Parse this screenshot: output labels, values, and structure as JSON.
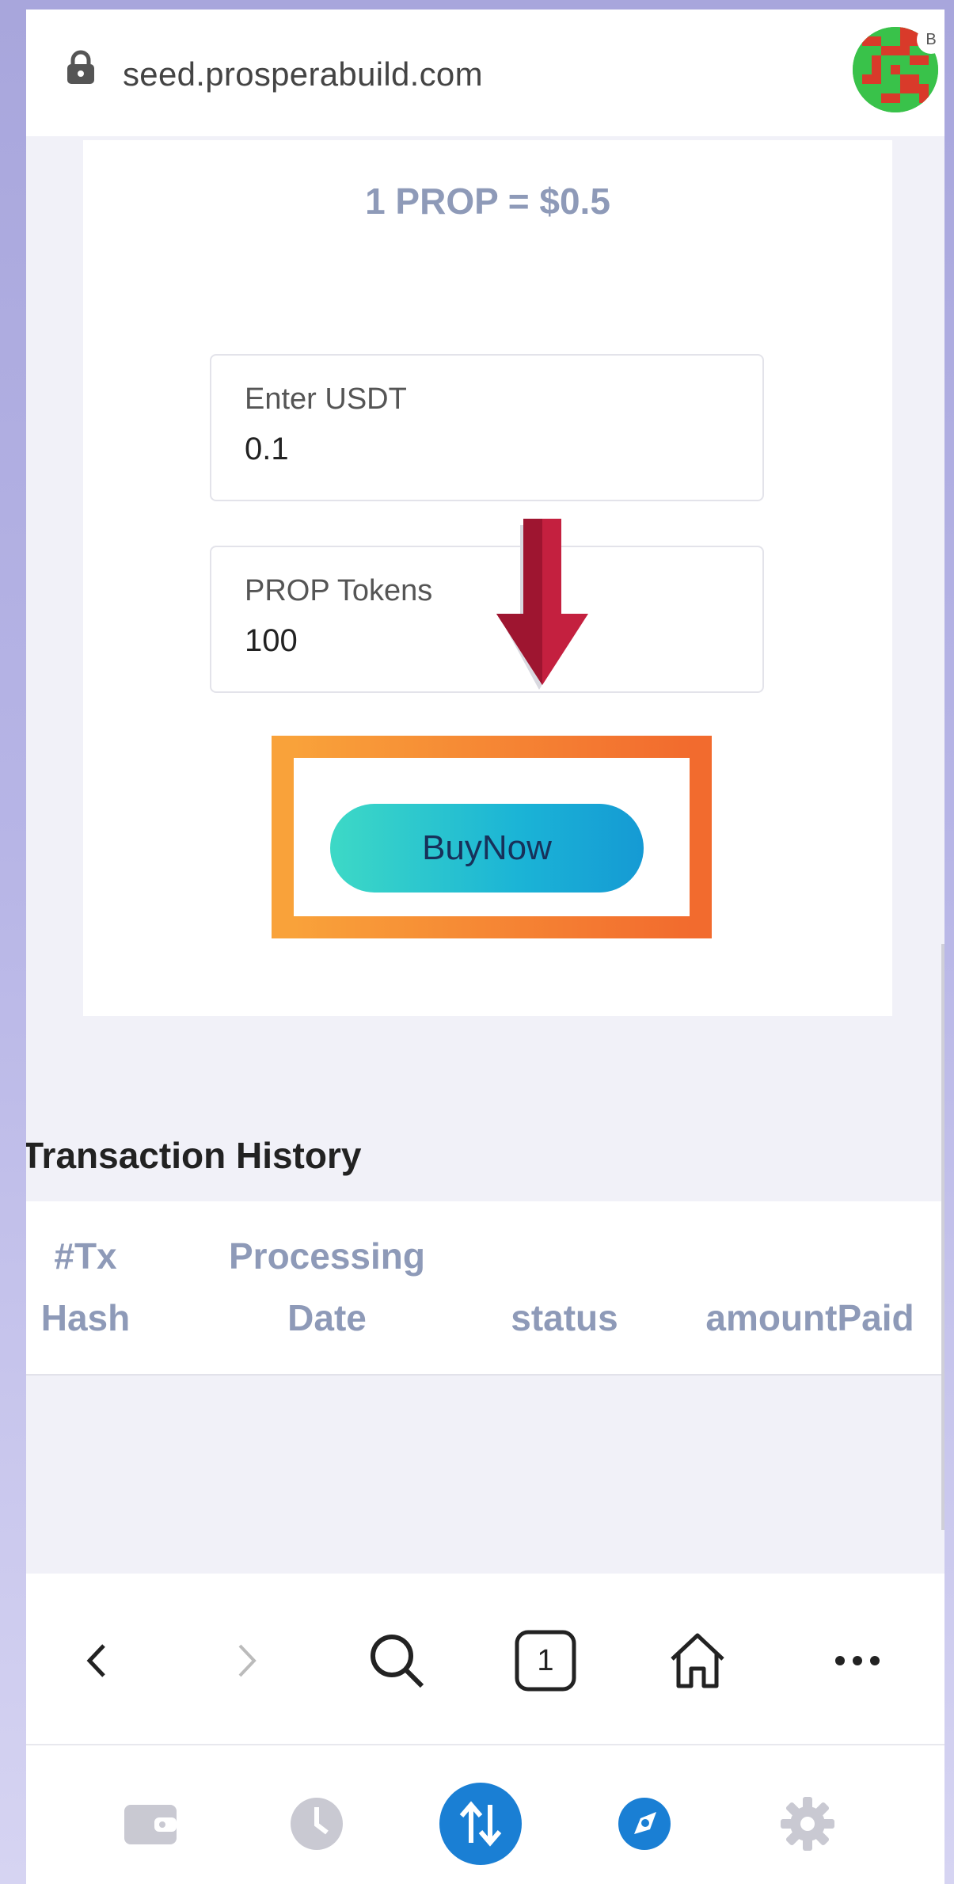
{
  "browser": {
    "url": "seed.prosperabuild.com",
    "avatar_badge": "B"
  },
  "card": {
    "rate": "1 PROP = $0.5",
    "usdt_field": {
      "label": "Enter USDT",
      "value": "0.1"
    },
    "prop_field": {
      "label": "PROP Tokens",
      "value": "100"
    },
    "buy_button": "BuyNow"
  },
  "transactions": {
    "title": "Transaction History",
    "columns": [
      "#Tx\nHash",
      "Processing\nDate",
      "status",
      "amountPaid"
    ],
    "rows": []
  },
  "browser_nav": {
    "items": [
      "back-icon",
      "forward-icon",
      "search-icon",
      "tabs-icon",
      "home-icon",
      "more-icon"
    ],
    "tab_count": "1"
  },
  "wallet_tabs": {
    "items": [
      "wallet-icon",
      "history-icon",
      "swap-icon",
      "discover-icon",
      "settings-icon"
    ],
    "active": "swap-icon"
  },
  "colors": {
    "accent_highlight": "#f47d31",
    "button_gradient": [
      "#3dd9c6",
      "#159ad4"
    ],
    "arrow": "#c4203f",
    "muted_text": "#8e9ab8",
    "active_tab": "#1a7fd4"
  }
}
